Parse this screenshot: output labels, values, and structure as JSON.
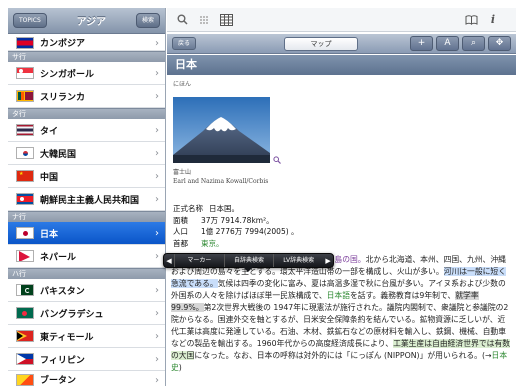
{
  "sidebar": {
    "back_button": "TOPICS",
    "title": "アジア",
    "search_button": "検索",
    "items": [
      {
        "type": "row",
        "name": "カンボジア",
        "flag": "cambodia",
        "partial": true
      },
      {
        "type": "section",
        "label": "サ行"
      },
      {
        "type": "row",
        "name": "シンガポール",
        "flag": "singapore"
      },
      {
        "type": "row",
        "name": "スリランカ",
        "flag": "srilanka"
      },
      {
        "type": "section",
        "label": "タ行"
      },
      {
        "type": "row",
        "name": "タイ",
        "flag": "thailand"
      },
      {
        "type": "row",
        "name": "大韓民国",
        "flag": "korea"
      },
      {
        "type": "row",
        "name": "中国",
        "flag": "china"
      },
      {
        "type": "row",
        "name": "朝鮮民主主義人民共和国",
        "flag": "dprk"
      },
      {
        "type": "section",
        "label": "ナ行"
      },
      {
        "type": "row",
        "name": "日本",
        "flag": "japan",
        "selected": true
      },
      {
        "type": "row",
        "name": "ネパール",
        "flag": "nepal"
      },
      {
        "type": "section",
        "label": "ハ行"
      },
      {
        "type": "row",
        "name": "パキスタン",
        "flag": "pakistan"
      },
      {
        "type": "row",
        "name": "バングラデシュ",
        "flag": "bangladesh"
      },
      {
        "type": "row",
        "name": "東ティモール",
        "flag": "easttimor"
      },
      {
        "type": "row",
        "name": "フィリピン",
        "flag": "philippines"
      },
      {
        "type": "row",
        "name": "ブータン",
        "flag": "bhutan",
        "partial": true
      }
    ]
  },
  "toolbar": {
    "icons": [
      "search-icon",
      "drag-handle-icon",
      "grid-icon",
      "book-icon",
      "info-icon"
    ]
  },
  "secondary_bar": {
    "back_button": "戻る",
    "segment_label": "マップ",
    "buttons": [
      "+",
      "A",
      "⌕",
      "✥"
    ]
  },
  "article": {
    "title": "日本",
    "reading": "にほん",
    "caption_title": "富士山",
    "caption_credit": "Earl and Nazima Kowall/Corbis",
    "facts": [
      {
        "label": "正式名称",
        "value": "日本国。"
      },
      {
        "label": "面積",
        "value": "37万 7914.78km²。"
      },
      {
        "label": "人口",
        "value": "1億 2776万 7994(2005) 。"
      },
      {
        "label": "首都",
        "value": "東京。"
      }
    ],
    "body": [
      {
        "t": "アジア大陸の東方に位置する、",
        "c": ""
      },
      {
        "t": "弧状に延びる列島の国。",
        "c": "hl-purple"
      },
      {
        "t": "北から北海道、本州、四国、九州、沖縄および周辺の島々を主とする。環太平洋造山帯の一部を構成し、火山が多い。",
        "c": ""
      },
      {
        "t": "河川は一般に短く急流である。",
        "c": "hl-blue"
      },
      {
        "t": "気候は四季の変化に富み、夏は高温多湿で秋に台風が多い。アイヌ系および少数の外国系の人々を除けばほぼ単一民族構成で、",
        "c": ""
      },
      {
        "t": "日本語",
        "c": "link"
      },
      {
        "t": "を話す。義務教育は9年制で、",
        "c": ""
      },
      {
        "t": "就学率99.9%。",
        "c": "hl-gray"
      },
      {
        "t": "第2次世界大戦後の 1947年に現憲法が施行された。議院内閣制で、衆議院と参議院の2院からなる。国連外交を軸とするが、日米安全保障条約を結んでいる。鉱物資源に乏しいが、近代工業は高度に発達している。石油、木材、鉄鉱石などの原材料を輸入し、鉄鋼、機械、自動車などの製品を輸出する。1960年代からの高度経済成長により、",
        "c": ""
      },
      {
        "t": "工業生産は自由経済世界では有数の大国",
        "c": "hl-green"
      },
      {
        "t": "になった。なお、日本の呼称は対外的には「にっぽん (NIPPON)」が用いられる。(→",
        "c": ""
      },
      {
        "t": "日本史",
        "c": "link"
      },
      {
        "t": ")",
        "c": ""
      }
    ]
  },
  "popup": {
    "items": [
      "マーカー",
      "自辞典検索",
      "LV辞典検索"
    ],
    "left_arrow": "◀",
    "right_arrow": "▶"
  },
  "colors": {
    "selected_row": "#0a55c8",
    "title_bar": "#5d728f",
    "link_green": "#2f8a33"
  }
}
